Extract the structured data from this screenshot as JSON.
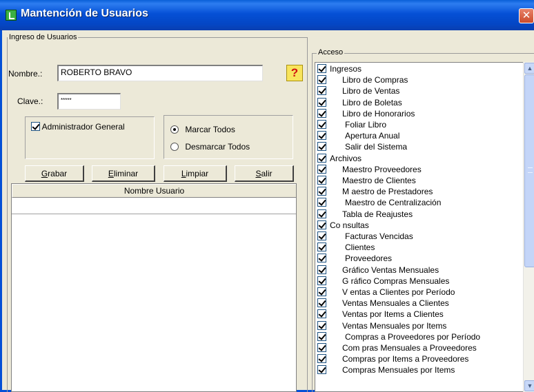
{
  "window": {
    "title": "Mantención de Usuarios",
    "close_glyph": "✕"
  },
  "ingreso": {
    "legend": "Ingreso de Usuarios",
    "nombre_label": "Nombre.:",
    "nombre_value": "ROBERTO BRAVO",
    "help_glyph": "?",
    "clave_label": "Clave.:",
    "clave_value": "*****",
    "admin_label": "Administrador General",
    "admin_checked": true,
    "radio_marcar": "Marcar Todos",
    "radio_desmarcar": "Desmarcar Todos",
    "radio_selected": "marcar"
  },
  "buttons": {
    "grabar": {
      "hot": "G",
      "rest": "rabar"
    },
    "eliminar": {
      "hot": "E",
      "rest": "liminar"
    },
    "limpiar": {
      "hot": "L",
      "rest": "impiar"
    },
    "salir": {
      "hot": "S",
      "rest": "alir"
    }
  },
  "grid": {
    "header": "Nombre Usuario"
  },
  "acceso": {
    "legend": "Acceso",
    "items": [
      {
        "label": "Ingresos",
        "checked": true,
        "indent": 0
      },
      {
        "label": "Libro de  Compras",
        "checked": true,
        "indent": 1
      },
      {
        "label": "Libro de  Ventas",
        "checked": true,
        "indent": 1
      },
      {
        "label": "Libro de  Boletas",
        "checked": true,
        "indent": 1
      },
      {
        "label": "Libro de  Honorarios",
        "checked": true,
        "indent": 1
      },
      {
        "label": "Foliar Libro",
        "checked": true,
        "indent": 2
      },
      {
        "label": "Apertura Anual",
        "checked": true,
        "indent": 2
      },
      {
        "label": "Salir del Sistema",
        "checked": true,
        "indent": 2
      },
      {
        "label": "Archivos",
        "checked": true,
        "indent": 0
      },
      {
        "label": "Maestro  Proveedores",
        "checked": true,
        "indent": 1
      },
      {
        "label": "Maestro de  Clientes",
        "checked": true,
        "indent": 1
      },
      {
        "label": "M aestro de Prestadores",
        "checked": true,
        "indent": 1
      },
      {
        "label": "Maestro de Centralización",
        "checked": true,
        "indent": 2
      },
      {
        "label": "Tabla de  Reajustes",
        "checked": true,
        "indent": 1
      },
      {
        "label": "Co nsultas",
        "checked": true,
        "indent": 0
      },
      {
        "label": "Facturas Vencidas",
        "checked": true,
        "indent": 2
      },
      {
        "label": "Clientes",
        "checked": true,
        "indent": 2
      },
      {
        "label": "Proveedores",
        "checked": true,
        "indent": 2
      },
      {
        "label": "Gráfico  Ventas Mensuales",
        "checked": true,
        "indent": 1
      },
      {
        "label": "G ráfico Compras Mensuales",
        "checked": true,
        "indent": 1
      },
      {
        "label": "V entas a Clientes por Período",
        "checked": true,
        "indent": 1
      },
      {
        "label": "Ventas  Mensuales a Clientes",
        "checked": true,
        "indent": 1
      },
      {
        "label": "Ventas por Items a Clientes",
        "checked": true,
        "indent": 1
      },
      {
        "label": "Ventas Mensuales por Items",
        "checked": true,
        "indent": 1
      },
      {
        "label": "Compras a Proveedores por Período",
        "checked": true,
        "indent": 2
      },
      {
        "label": "Com pras Mensuales a Proveedores",
        "checked": true,
        "indent": 1
      },
      {
        "label": "Compras por Items a Proveedores",
        "checked": true,
        "indent": 1
      },
      {
        "label": "Compras Mensuales por Items",
        "checked": true,
        "indent": 1
      }
    ],
    "scroll_up_glyph": "▲",
    "scroll_down_glyph": "▼"
  }
}
